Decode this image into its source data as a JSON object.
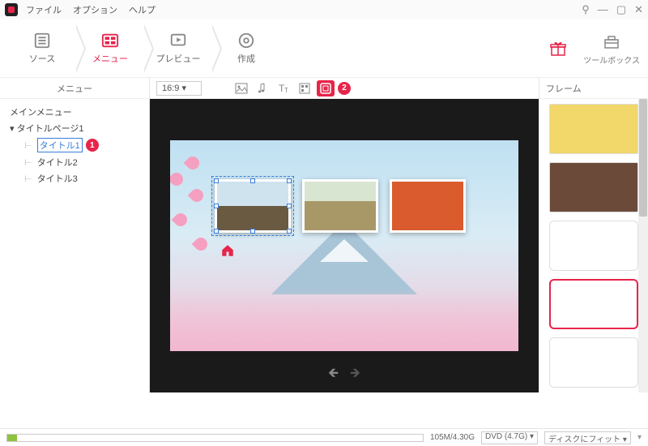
{
  "menubar": {
    "file": "ファイル",
    "options": "オプション",
    "help": "ヘルプ"
  },
  "steps": {
    "source": "ソース",
    "menu": "メニュー",
    "preview": "プレビュー",
    "create": "作成"
  },
  "right_tools": {
    "toolbox": "ツールボックス"
  },
  "left_panel": {
    "title": "メニュー",
    "main_menu": "メインメニュー",
    "title_page": "タイトルページ1",
    "titles": [
      "タイトル1",
      "タイトル2",
      "タイトル3"
    ]
  },
  "center_toolbar": {
    "aspect": "16:9"
  },
  "annotations": {
    "badge1": "1",
    "badge2": "2"
  },
  "right_panel": {
    "title": "フレーム"
  },
  "status": {
    "usage": "105M/4.30G",
    "disc": "DVD (4.7G)",
    "fit": "ディスクにフィット"
  }
}
